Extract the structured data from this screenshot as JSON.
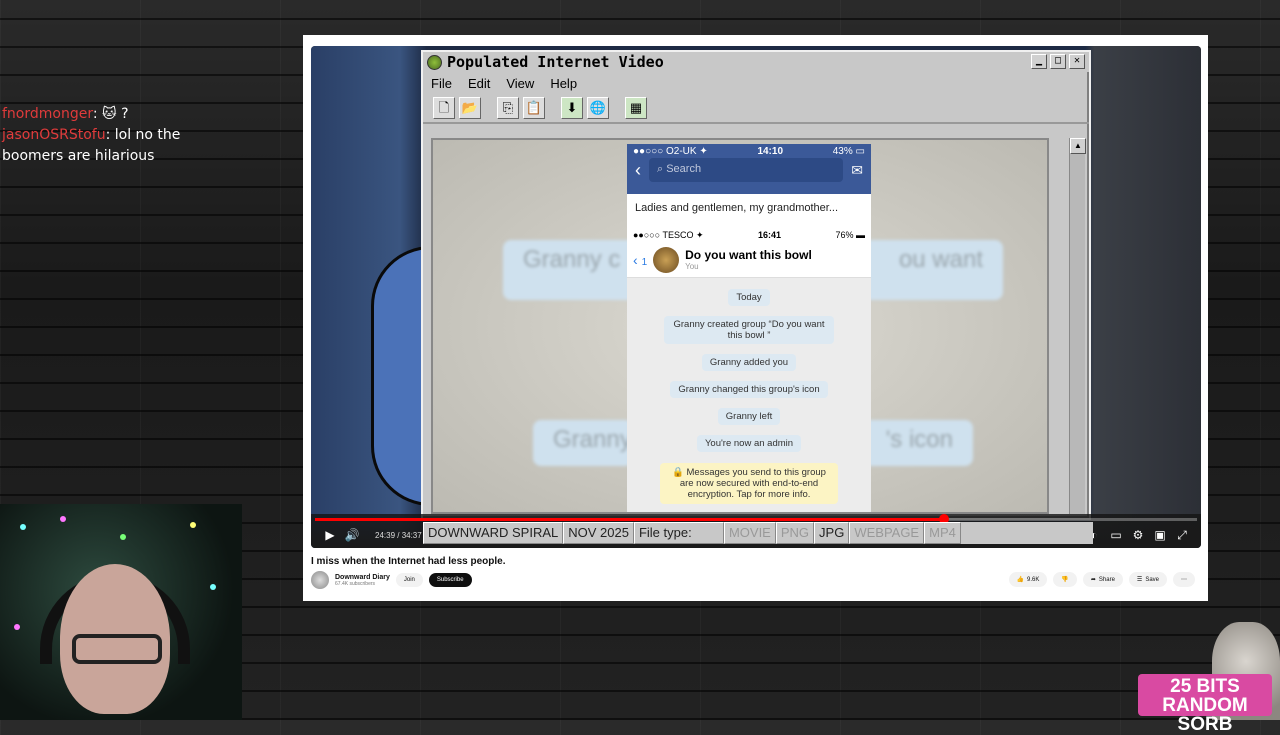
{
  "chat": [
    {
      "user": "fnordmonger",
      "text": "🐱 ?"
    },
    {
      "user": "jasonOSRStofu",
      "text": "lol no the boomers are hilarious"
    }
  ],
  "window": {
    "title": "Populated Internet Video",
    "menu": [
      "File",
      "Edit",
      "View",
      "Help"
    ],
    "min": "▁",
    "max": "□",
    "close": "✕"
  },
  "phone": {
    "fb_carrier": "●●○○○ O2-UK ✦",
    "fb_time": "14:10",
    "fb_battery": "43% ▭",
    "search_placeholder": "Search",
    "caption": "Ladies and gentlemen, my grandmother...",
    "wa_carrier": "●●○○○ TESCO ✦",
    "wa_time": "16:41",
    "wa_battery": "76% ▬",
    "back_count": "1",
    "group_name": "Do you want this bowl",
    "you": "You",
    "messages": [
      "Today",
      "Granny created group “Do you want this bowl ”",
      "Granny added you",
      "Granny changed this group's icon",
      "Granny left",
      "You're now an admin"
    ],
    "encryption": "🔒 Messages you send to this group are now secured with end-to-end encryption. Tap for more info."
  },
  "blurred": {
    "left_top": "Granny c",
    "right_top": "ou want",
    "left_bottom": "Granny",
    "right_bottom": "'s icon"
  },
  "bottom_fields": {
    "channel": "DOWNWARD SPIRAL",
    "date": "NOV 2025",
    "filetype_label": "File type:",
    "types": [
      "MOVIE",
      "PNG",
      "JPG",
      "WEBPAGE",
      "MP4"
    ]
  },
  "player": {
    "time": "24:39 / 34:37",
    "progress": 0.713
  },
  "video": {
    "title": "I miss when the Internet had less people.",
    "channel": "Downward Diary",
    "subscribers": "67.4K subscribers",
    "join": "Join",
    "subscribe": "Subscribe",
    "likes": "9.6K",
    "share": "Share",
    "save": "Save"
  },
  "brand": {
    "line1": "25 BITS",
    "line2": "RANDOM SORB"
  },
  "colors": {
    "facebook": "#3b5998",
    "progress": "#ff0000",
    "brand": "#d94aa2"
  }
}
